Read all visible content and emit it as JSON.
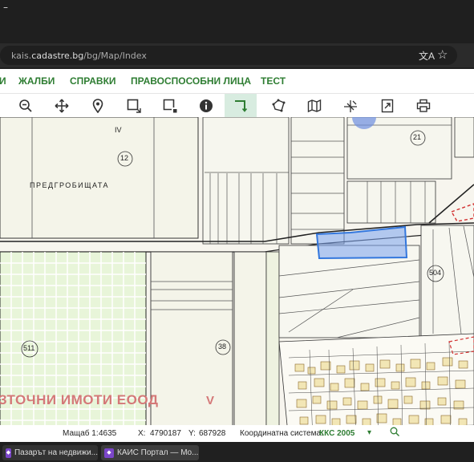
{
  "browser": {
    "url_prefix": "kais.",
    "url_domain": "cadastre.bg",
    "url_path": "/bg/Map/Index",
    "window_control": "–"
  },
  "menu": {
    "items": [
      {
        "label": "И"
      },
      {
        "label": "ЖАЛБИ"
      },
      {
        "label": "СПРАВКИ"
      },
      {
        "label": "ПРАВОСПОСОБНИ ЛИЦА"
      },
      {
        "label": "ТЕСТ"
      }
    ]
  },
  "toolbar": {
    "tools": [
      "zoom-out-icon",
      "pan-icon",
      "locate-icon",
      "select-rectangle-icon",
      "deselect-rectangle-icon",
      "info-icon",
      "measure-icon",
      "polygon-icon",
      "map-layers-icon",
      "coordinates-icon",
      "export-icon",
      "print-icon"
    ],
    "active_tool": "measure-icon",
    "accent_color": "#2e7d32"
  },
  "map": {
    "labels": {
      "region_name": "ПРЕДГРОБИЩАТА",
      "quarter_iv": "IV",
      "quarter_v": "V",
      "parcel_12": "12",
      "parcel_21": "21",
      "parcel_511": "511",
      "parcel_38": "38",
      "parcel_504": "504",
      "watermark": "ЗТОЧНИ ИМОТИ ЕООД"
    },
    "selection_color": "#7aa3ee",
    "agri_color": "#e8f5d9",
    "urban_color": "#f2e6b5"
  },
  "status": {
    "scale_label": "Мащаб 1:",
    "scale_value": "4635",
    "x_label": "X:",
    "x_value": "4790187",
    "y_label": "Y:",
    "y_value": "687928",
    "crs_label": "Координатна система:",
    "crs_value": "ККС 2005"
  },
  "taskbar": {
    "tasks": [
      {
        "label": "Пазарът на недвижи..."
      },
      {
        "label": "КАИС Портал — Mo..."
      }
    ]
  }
}
